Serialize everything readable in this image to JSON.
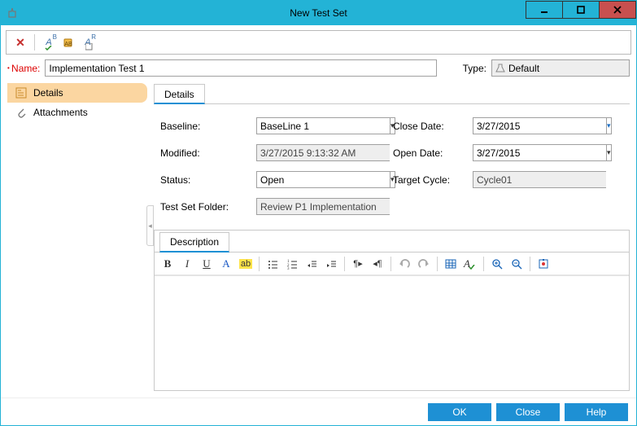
{
  "window": {
    "title": "New Test Set"
  },
  "nameRow": {
    "label": "Name:",
    "value": "Implementation Test 1",
    "typeLabel": "Type:",
    "typeValue": "Default"
  },
  "sidebar": {
    "items": [
      {
        "label": "Details"
      },
      {
        "label": "Attachments"
      }
    ]
  },
  "tabs": {
    "details": "Details",
    "description": "Description"
  },
  "form": {
    "baselineLabel": "Baseline:",
    "baselineValue": "BaseLine 1",
    "closeDateLabel": "Close Date:",
    "closeDateValue": "3/27/2015",
    "modifiedLabel": "Modified:",
    "modifiedValue": "3/27/2015 9:13:32 AM",
    "openDateLabel": "Open Date:",
    "openDateValue": "3/27/2015",
    "statusLabel": "Status:",
    "statusValue": "Open",
    "targetCycleLabel": "Target Cycle:",
    "targetCycleValue": "Cycle01",
    "testSetFolderLabel": "Test Set Folder:",
    "testSetFolderValue": "Review P1 Implementation"
  },
  "footer": {
    "ok": "OK",
    "close": "Close",
    "help": "Help"
  }
}
